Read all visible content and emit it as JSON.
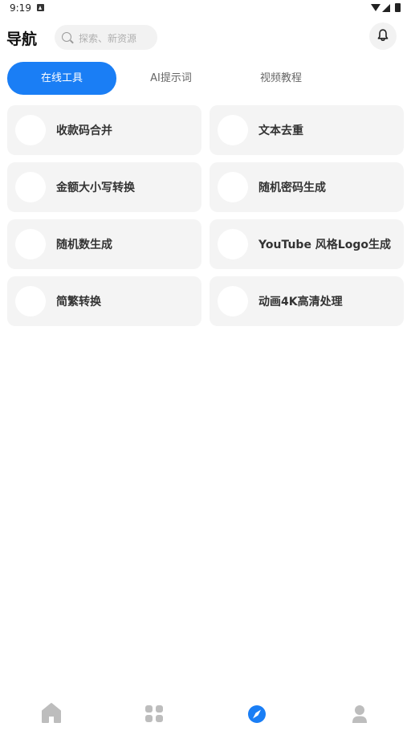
{
  "status_bar": {
    "time": "9:19"
  },
  "header": {
    "title": "导航",
    "search_placeholder": "探索、新资源"
  },
  "tabs": [
    {
      "label": "在线工具",
      "active": true
    },
    {
      "label": "AI提示词",
      "active": false
    },
    {
      "label": "视频教程",
      "active": false
    }
  ],
  "tools": [
    {
      "label": "收款码合并"
    },
    {
      "label": "文本去重"
    },
    {
      "label": "金额大小写转换"
    },
    {
      "label": "随机密码生成"
    },
    {
      "label": "随机数生成"
    },
    {
      "label": "YouTube 风格Logo生成"
    },
    {
      "label": "简繁转换"
    },
    {
      "label": "动画4K高清处理"
    }
  ],
  "bottom_nav": [
    {
      "icon": "home-icon",
      "active": false
    },
    {
      "icon": "apps-icon",
      "active": false
    },
    {
      "icon": "compass-icon",
      "active": true
    },
    {
      "icon": "profile-icon",
      "active": false
    }
  ],
  "colors": {
    "accent": "#1a7ef5",
    "inactive_icon": "#bdbdbd",
    "card_bg": "#f4f4f4"
  }
}
